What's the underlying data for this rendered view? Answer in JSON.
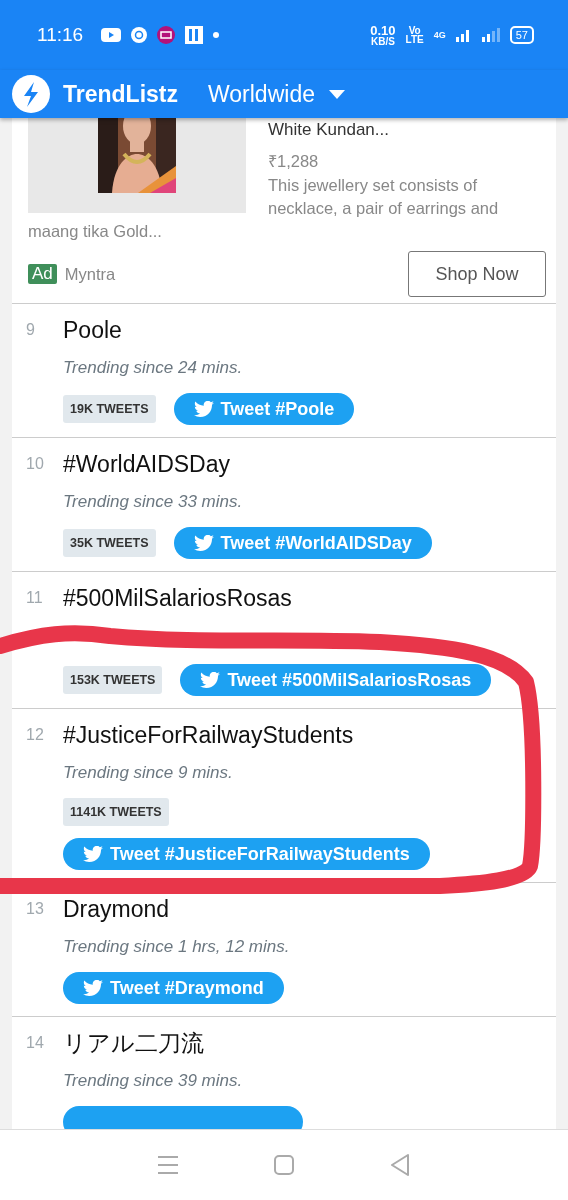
{
  "status_bar": {
    "time": "11:16",
    "speed": "0.10",
    "speed_unit": "KB/S",
    "volte": "Vo",
    "volte_sub": "LTE",
    "network": "4G",
    "battery": "57"
  },
  "app_bar": {
    "title": "TrendListz",
    "region": "Worldwide"
  },
  "ad": {
    "title": "White Kundan...",
    "price": "₹1,288",
    "description": "This jewellery set consists of necklace, a pair of earrings and maang tika Gold...",
    "badge": "Ad",
    "advertiser": "Myntra",
    "button": "Shop Now"
  },
  "trends": [
    {
      "rank": "9",
      "name": "Poole",
      "since": "Trending since 24 mins.",
      "tweets": "19K TWEETS",
      "tweet_label": "Tweet #Poole"
    },
    {
      "rank": "10",
      "name": "#WorldAIDSDay",
      "since": "Trending since 33 mins.",
      "tweets": "35K TWEETS",
      "tweet_label": "Tweet #WorldAIDSDay"
    },
    {
      "rank": "11",
      "name": "#500MilSalariosRosas",
      "tweets": "153K TWEETS",
      "tweet_label": "Tweet #500MilSalariosRosas"
    },
    {
      "rank": "12",
      "name": "#JusticeForRailwayStudents",
      "since": "Trending since 9 mins.",
      "tweets": "1141K TWEETS",
      "tweet_label": "Tweet #JusticeForRailwayStudents"
    },
    {
      "rank": "13",
      "name": "Draymond",
      "since": "Trending since 1 hrs, 12 mins.",
      "tweet_label": "Tweet #Draymond"
    },
    {
      "rank": "14",
      "name": "リアル二刀流",
      "since": "Trending since 39 mins."
    }
  ]
}
